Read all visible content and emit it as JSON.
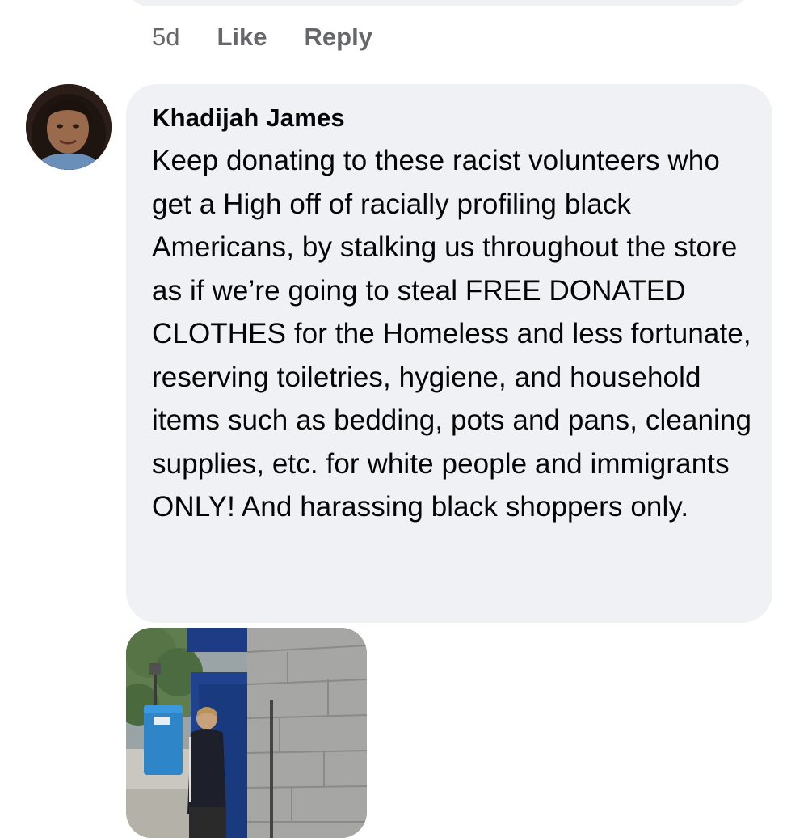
{
  "previous_comment": {
    "time": "5d",
    "like_label": "Like",
    "reply_label": "Reply"
  },
  "comment": {
    "author": "Khadijah James",
    "text": "Keep donating to these racist volunteers who get a High off of racially profiling black Americans, by stalking us throughout the store as if we’re going to steal FREE DONATED CLOTHES for the Homeless and less fortunate, reserving toiletries, hygiene, and household items such as bedding, pots and pans, cleaning supplies, etc. for white people and immigrants ONLY! And harassing black shoppers only."
  },
  "colors": {
    "bubble_background": "#f0f1f4",
    "meta_text": "#65676b",
    "body_text": "#050505"
  }
}
